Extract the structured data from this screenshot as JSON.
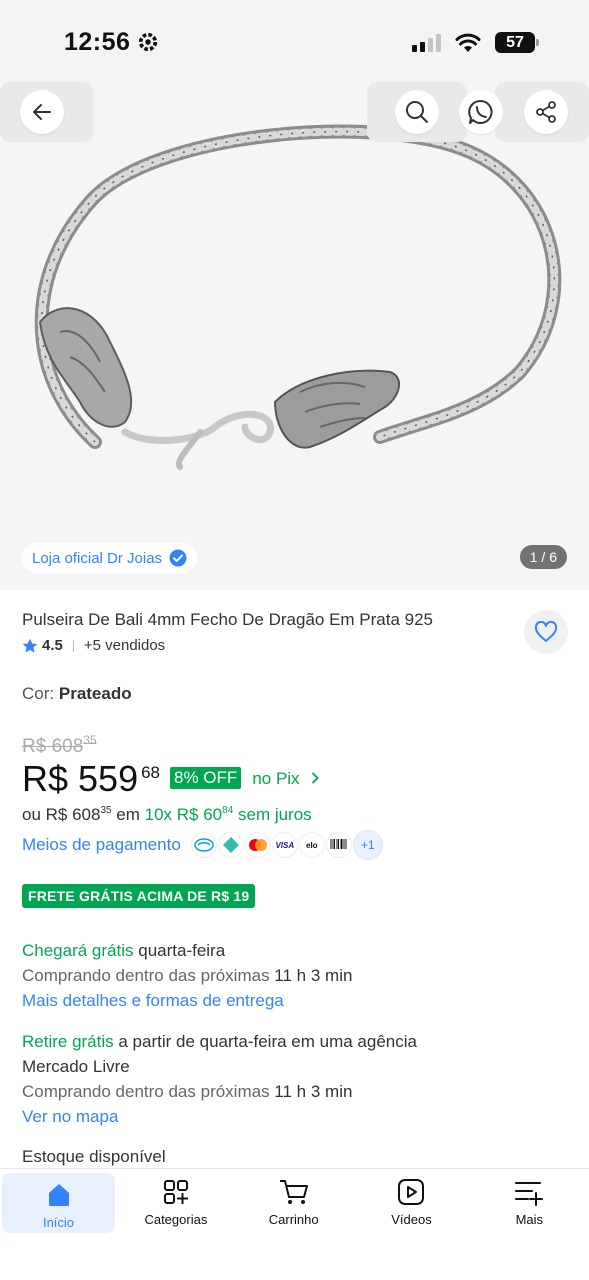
{
  "status_bar": {
    "time": "12:56",
    "battery": "57",
    "icons": [
      "gear-icon",
      "signal-icon",
      "wifi-icon",
      "battery-icon"
    ]
  },
  "hero": {
    "store_badge": "Loja oficial Dr Joias",
    "counter": "1 / 6",
    "actions": [
      "back-icon",
      "search-icon",
      "whatsapp-icon",
      "share-icon"
    ]
  },
  "product": {
    "title": "Pulseira De Bali 4mm Fecho De Dragão Em Prata 925",
    "rating": "4.5",
    "sold": "+5 vendidos",
    "color_label": "Cor:",
    "color_value": "Prateado"
  },
  "price": {
    "old_prefix": "R$ 608",
    "old_cents": "35",
    "main": "R$ 559",
    "cents": "68",
    "discount": "8% OFF",
    "pix": "no Pix",
    "installment_prefix": "ou R$ 608",
    "installment_prefix_cents": "35",
    "installment_mid": " em ",
    "installment_green": "10x R$ 60",
    "installment_green_cents": "84",
    "installment_suffix": " sem juros"
  },
  "payment": {
    "link": "Meios de pagamento",
    "methods": [
      "mercado-pago-icon",
      "pix-icon",
      "mastercard-icon",
      "visa-icon",
      "elo-icon",
      "boleto-icon"
    ],
    "more": "+1"
  },
  "shipping": {
    "free_badge": "FRETE GRÁTIS ACIMA DE R$ 19",
    "arrive_green": "Chegará grátis",
    "arrive_rest": " quarta-feira",
    "buy_within_label": "Comprando dentro das próximas",
    "buy_within_value": " 11 h 3 min",
    "details_link": "Mais detalhes e formas de entrega",
    "pickup_green": "Retire grátis",
    "pickup_rest": " a partir de quarta-feira em uma agência",
    "pickup_rest2": "Mercado Livre",
    "buy_within_label2": "Comprando dentro das próximas",
    "buy_within_value2": " 11 h 3 min",
    "map_link": "Ver no mapa"
  },
  "stock": "Estoque disponível",
  "nav": {
    "items": [
      {
        "label": "Início",
        "icon": "home-icon"
      },
      {
        "label": "Categorias",
        "icon": "categories-icon"
      },
      {
        "label": "Carrinho",
        "icon": "cart-icon"
      },
      {
        "label": "Vídeos",
        "icon": "video-icon"
      },
      {
        "label": "Mais",
        "icon": "menu-plus-icon"
      }
    ]
  },
  "colors": {
    "accent_blue": "#3483fa",
    "green": "#00a650",
    "hero_bg": "#f5f5f5"
  }
}
